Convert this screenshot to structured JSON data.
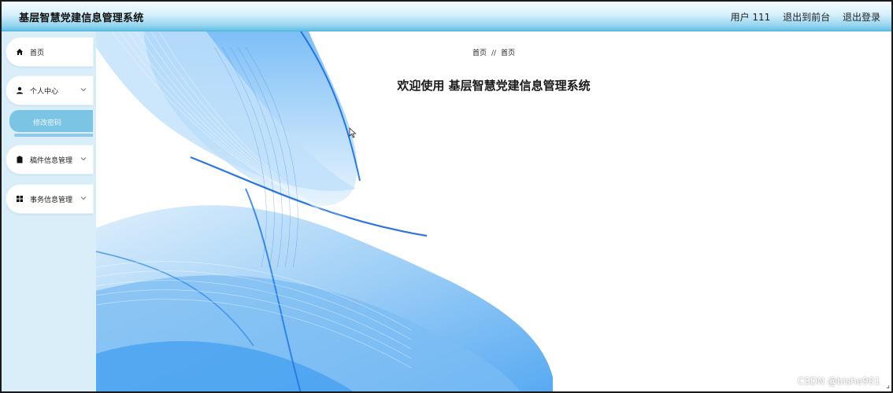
{
  "header": {
    "app_title": "基层智慧党建信息管理系统",
    "user_label": "用户 111",
    "exit_to_front": "退出到前台",
    "logout": "退出登录"
  },
  "sidebar": {
    "items": [
      {
        "label": "首页",
        "icon": "home-icon"
      },
      {
        "label": "个人中心",
        "icon": "user-icon"
      },
      {
        "label": "稿件信息管理",
        "icon": "clipboard-icon"
      },
      {
        "label": "事务信息管理",
        "icon": "grid-icon"
      }
    ],
    "sub_items": [
      {
        "label": "修改密码"
      }
    ]
  },
  "main": {
    "breadcrumb": [
      "首页",
      "首页"
    ],
    "breadcrumb_sep": "//",
    "welcome": "欢迎使用 基层智慧党建信息管理系统"
  },
  "watermark": "CSDN @bishe901",
  "colors": {
    "header_gradient_bottom": "#5fbfe5",
    "sidebar_bg": "#d9eef8",
    "active_sub_item": "#7cc4e4",
    "art_blue": "#1e8cf0"
  }
}
